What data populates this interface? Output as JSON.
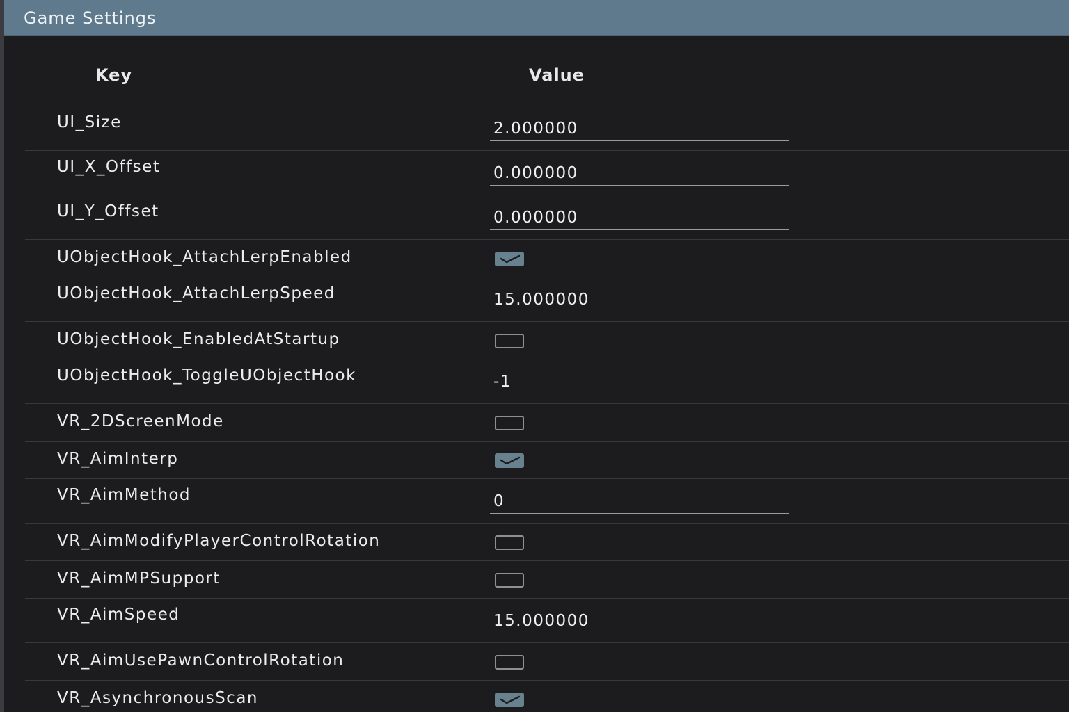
{
  "window": {
    "title": "Game Settings"
  },
  "table": {
    "key_header": "Key",
    "value_header": "Value"
  },
  "rows": [
    {
      "key": "UI_Size",
      "type": "text",
      "value": "2.000000"
    },
    {
      "key": "UI_X_Offset",
      "type": "text",
      "value": "0.000000"
    },
    {
      "key": "UI_Y_Offset",
      "type": "text",
      "value": "0.000000"
    },
    {
      "key": "UObjectHook_AttachLerpEnabled",
      "type": "checkbox",
      "checked": true
    },
    {
      "key": "UObjectHook_AttachLerpSpeed",
      "type": "text",
      "value": "15.000000"
    },
    {
      "key": "UObjectHook_EnabledAtStartup",
      "type": "checkbox",
      "checked": false
    },
    {
      "key": "UObjectHook_ToggleUObjectHook",
      "type": "text",
      "value": "-1"
    },
    {
      "key": "VR_2DScreenMode",
      "type": "checkbox",
      "checked": false
    },
    {
      "key": "VR_AimInterp",
      "type": "checkbox",
      "checked": true
    },
    {
      "key": "VR_AimMethod",
      "type": "text",
      "value": "0"
    },
    {
      "key": "VR_AimModifyPlayerControlRotation",
      "type": "checkbox",
      "checked": false
    },
    {
      "key": "VR_AimMPSupport",
      "type": "checkbox",
      "checked": false
    },
    {
      "key": "VR_AimSpeed",
      "type": "text",
      "value": "15.000000"
    },
    {
      "key": "VR_AimUsePawnControlRotation",
      "type": "checkbox",
      "checked": false
    },
    {
      "key": "VR_AsynchronousScan",
      "type": "checkbox",
      "checked": true
    }
  ],
  "colors": {
    "titlebar": "#5e7a8c",
    "background": "#1c1c1e",
    "checkbox_checked": "#67818f"
  }
}
